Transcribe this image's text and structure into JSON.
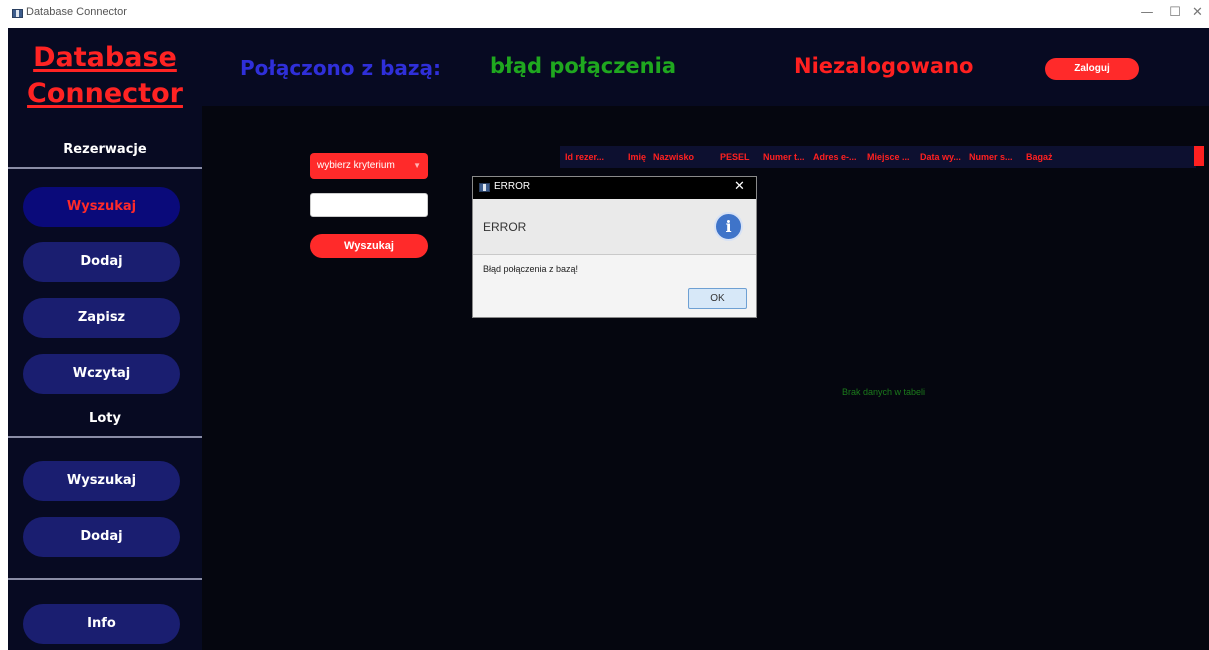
{
  "window": {
    "title": "Database Connector",
    "controls": [
      "—",
      "☐",
      "✕"
    ]
  },
  "sidebar": {
    "logo_line1": "Database",
    "logo_line2": "Connector",
    "sections": [
      {
        "label": "Rezerwacje",
        "buttons": [
          "Wyszukaj",
          "Dodaj",
          "Zapisz",
          "Wczytaj"
        ]
      },
      {
        "label": "Loty",
        "buttons": [
          "Wyszukaj",
          "Dodaj"
        ]
      }
    ],
    "info_button": "Info",
    "active_button": "Rezerwacje/Wyszukaj"
  },
  "header": {
    "connection_label": "Połączono z bazą:",
    "connection_status": "błąd połączenia",
    "login_status": "Niezalogowano",
    "login_button": "Zaloguj"
  },
  "search": {
    "criteria_select": "wybierz kryterium",
    "input_value": "",
    "search_button": "Wyszukaj"
  },
  "table": {
    "columns": [
      "Id rezer...",
      "Imię",
      "Nazwisko",
      "PESEL",
      "Numer t...",
      "Adres e-...",
      "Miejsce ...",
      "Data wy...",
      "Numer s...",
      "Bagaż"
    ],
    "empty_message": "Brak danych w tabeli"
  },
  "dialog": {
    "title": "ERROR",
    "header": "ERROR",
    "message": "Błąd połączenia z bazą!",
    "ok_button": "OK",
    "icon": "info-icon"
  },
  "colors": {
    "accent_red": "#ff2a2a",
    "nav_blue": "#1a1e70",
    "status_green": "#1fa81f",
    "label_blue": "#2f2fd9",
    "background": "#05060f"
  }
}
